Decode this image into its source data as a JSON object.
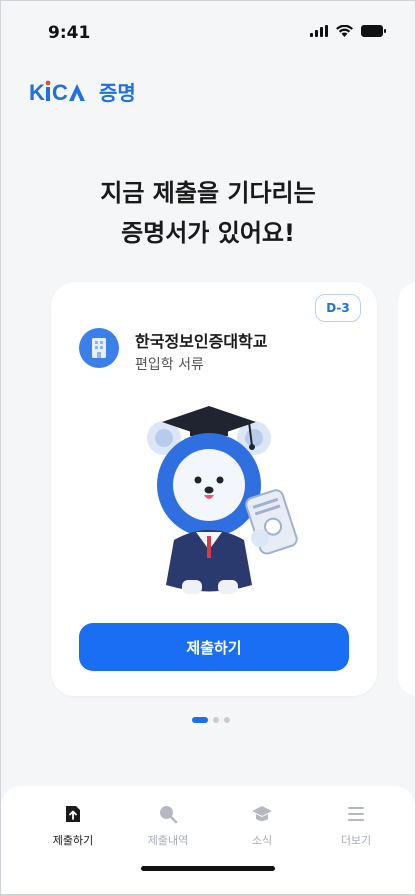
{
  "status_bar": {
    "time": "9:41",
    "icons": [
      "signal-icon",
      "wifi-icon",
      "battery-icon"
    ]
  },
  "logo": {
    "brand": "KICA",
    "suffix": "증명",
    "color": "#1f6fe5"
  },
  "heading": {
    "line1": "지금 제출을 기다리는",
    "line2": "증명서가 있어요!"
  },
  "card": {
    "badge": "D-3",
    "institution": "한국정보인증대학교",
    "document_type": "편입학 서류",
    "submit_label": "제출하기"
  },
  "carousel": {
    "page_count": 3,
    "active_index": 0
  },
  "bottom_nav": {
    "items": [
      {
        "label": "제출하기",
        "icon": "upload-icon",
        "active": true
      },
      {
        "label": "제출내역",
        "icon": "search-icon",
        "active": false
      },
      {
        "label": "소식",
        "icon": "graduation-cap-icon",
        "active": false
      },
      {
        "label": "더보기",
        "icon": "menu-icon",
        "active": false
      }
    ]
  },
  "colors": {
    "accent": "#1a6ef3",
    "background": "#f5f6f8",
    "inactive": "#a8adb5"
  }
}
